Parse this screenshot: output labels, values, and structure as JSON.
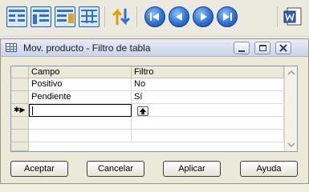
{
  "toolbar": {
    "icons": [
      "table-view-icon",
      "list-view-icon",
      "edit-table-icon",
      "grid-icon",
      "sort-icon",
      "first-record-icon",
      "previous-record-icon",
      "next-record-icon",
      "last-record-icon",
      "word-export-icon"
    ]
  },
  "window": {
    "title": "Mov. producto - Filtro de tabla",
    "controls": [
      "minimize",
      "restore",
      "close"
    ]
  },
  "grid": {
    "columns": [
      "Campo",
      "Filtro"
    ],
    "rows": [
      {
        "campo": "Positivo",
        "filtro": "No"
      },
      {
        "campo": "Pendiente",
        "filtro": "Sí"
      },
      {
        "campo": "",
        "filtro": ""
      }
    ],
    "new_row_marker": "✱▶"
  },
  "buttons": {
    "accept": "Aceptar",
    "cancel": "Cancelar",
    "apply": "Aplicar",
    "help": "Ayuda"
  },
  "colors": {
    "accent_blue": "#2b73d9",
    "window_bg": "#ece9d8",
    "grid_border": "#7f9db9"
  }
}
